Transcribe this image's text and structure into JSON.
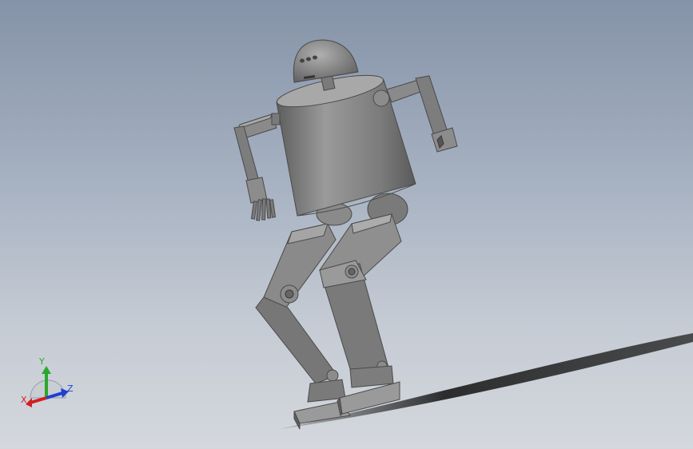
{
  "viewport": {
    "colors": {
      "background_top": "#8593a8",
      "background_bottom": "#d4d8dd",
      "part": "#7f7f7f",
      "part_dark": "#555555",
      "part_light": "#a8a8a8",
      "shadow": "#2a2a2a"
    }
  },
  "triad": {
    "x_label": "X",
    "y_label": "Y",
    "z_label": "Z",
    "x_color": "#d21f1f",
    "y_color": "#2aa82a",
    "z_color": "#1f3fd2"
  }
}
